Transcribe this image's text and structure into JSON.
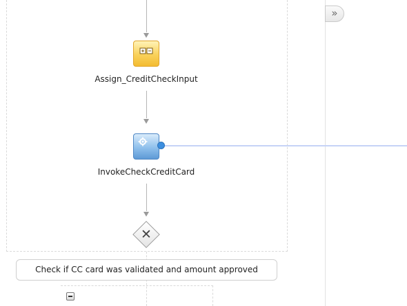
{
  "process": {
    "assign_activity": {
      "label": "Assign_CreditCheckInput",
      "icon": "assign-icon",
      "accent": "#f3bc32"
    },
    "invoke_activity": {
      "label": "InvokeCheckCreditCard",
      "icon": "invoke-gear-icon",
      "accent": "#5e9ad6"
    },
    "switch_gateway": {
      "symbol": "✕",
      "icon": "switch-gateway-icon"
    },
    "case_condition": {
      "label": "Check if CC card was validated and amount approved"
    },
    "collapse_control": {
      "icon": "collapse-minus-icon"
    }
  },
  "panel_toggle": {
    "symbol": "»",
    "icon": "expand-panel-icon"
  },
  "colors": {
    "partner_link_line": "#c6d3f7",
    "port_dot": "#3c8fe0"
  }
}
